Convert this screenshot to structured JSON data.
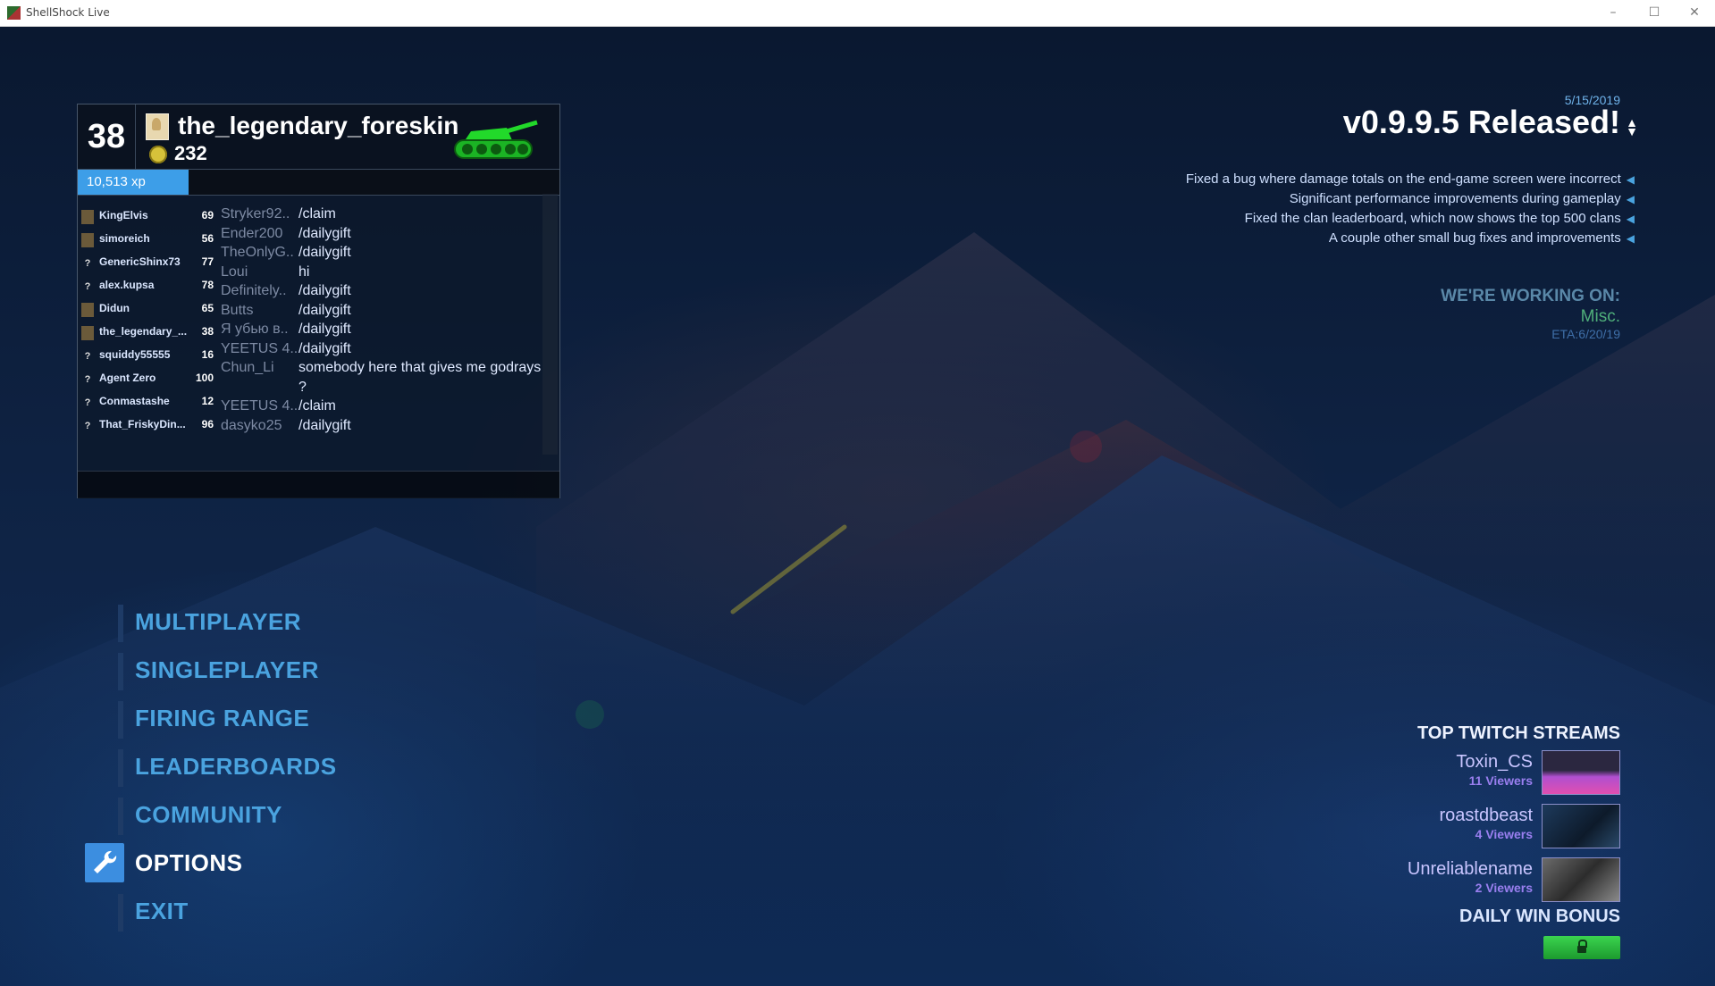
{
  "window": {
    "title": "ShellShock Live",
    "minimize_glyph": "–",
    "maximize_glyph": "☐",
    "close_glyph": "✕"
  },
  "player": {
    "level": "38",
    "name": "the_legendary_foreskin",
    "coins": "232",
    "xp_text": "10,513 xp",
    "xp_progress": 0.23
  },
  "online_players": [
    {
      "name": "KingElvis",
      "level": "69",
      "avatar": "custom"
    },
    {
      "name": "simoreich",
      "level": "56",
      "avatar": "custom"
    },
    {
      "name": "GenericShinx73",
      "level": "77",
      "avatar": "?"
    },
    {
      "name": "alex.kupsa",
      "level": "78",
      "avatar": "?"
    },
    {
      "name": "Didun",
      "level": "65",
      "avatar": "custom"
    },
    {
      "name": "the_legendary_...",
      "level": "38",
      "avatar": "custom"
    },
    {
      "name": "squiddy55555",
      "level": "16",
      "avatar": "?"
    },
    {
      "name": "Agent Zero",
      "level": "100",
      "avatar": "?"
    },
    {
      "name": "Conmastashe",
      "level": "12",
      "avatar": "?"
    },
    {
      "name": "That_FriskyDin...",
      "level": "96",
      "avatar": "?"
    }
  ],
  "chat": [
    {
      "sender": "Stryker92..",
      "message": "/claim"
    },
    {
      "sender": "Ender200",
      "message": "/dailygift"
    },
    {
      "sender": "TheOnlyG..",
      "message": "/dailygift"
    },
    {
      "sender": "Loui",
      "message": "hi"
    },
    {
      "sender": "Definitely..",
      "message": "/dailygift"
    },
    {
      "sender": "Butts",
      "message": "/dailygift"
    },
    {
      "sender": "Я убью в..",
      "message": "/dailygift"
    },
    {
      "sender": "YEETUS 4..",
      "message": "/dailygift"
    },
    {
      "sender": "Chun_Li",
      "message": "somebody here that gives me godrays ?"
    },
    {
      "sender": "YEETUS 4..",
      "message": "/claim"
    },
    {
      "sender": "dasyko25",
      "message": "/dailygift"
    }
  ],
  "menu": {
    "items": [
      "MULTIPLAYER",
      "SINGLEPLAYER",
      "FIRING RANGE",
      "LEADERBOARDS",
      "COMMUNITY",
      "OPTIONS",
      "EXIT"
    ],
    "selected": "OPTIONS"
  },
  "news": {
    "date": "5/15/2019",
    "title": "v0.9.9.5 Released!",
    "lines": [
      "Fixed a bug where damage totals on the end-game screen were incorrect",
      "Significant performance improvements during gameplay",
      "Fixed the clan leaderboard, which now shows the top 500 clans",
      "A couple other small bug fixes and improvements"
    ],
    "working_on_label": "WE'RE WORKING ON:",
    "working_on_item": "Misc.",
    "eta": "ETA:6/20/19"
  },
  "twitch": {
    "title": "TOP TWITCH STREAMS",
    "streams": [
      {
        "name": "Toxin_CS",
        "viewers": "11 Viewers"
      },
      {
        "name": "roastdbeast",
        "viewers": "4 Viewers"
      },
      {
        "name": "Unreliablename",
        "viewers": "2 Viewers"
      }
    ]
  },
  "daily_win_bonus": {
    "label": "DAILY WIN BONUS",
    "locked": true
  },
  "colors": {
    "accent_blue": "#4aa3df",
    "xp_blue": "#3d9ee8",
    "tank_green": "#22d92a",
    "bonus_green": "#2fc243",
    "twitch_purple": "#9a7ff0"
  }
}
